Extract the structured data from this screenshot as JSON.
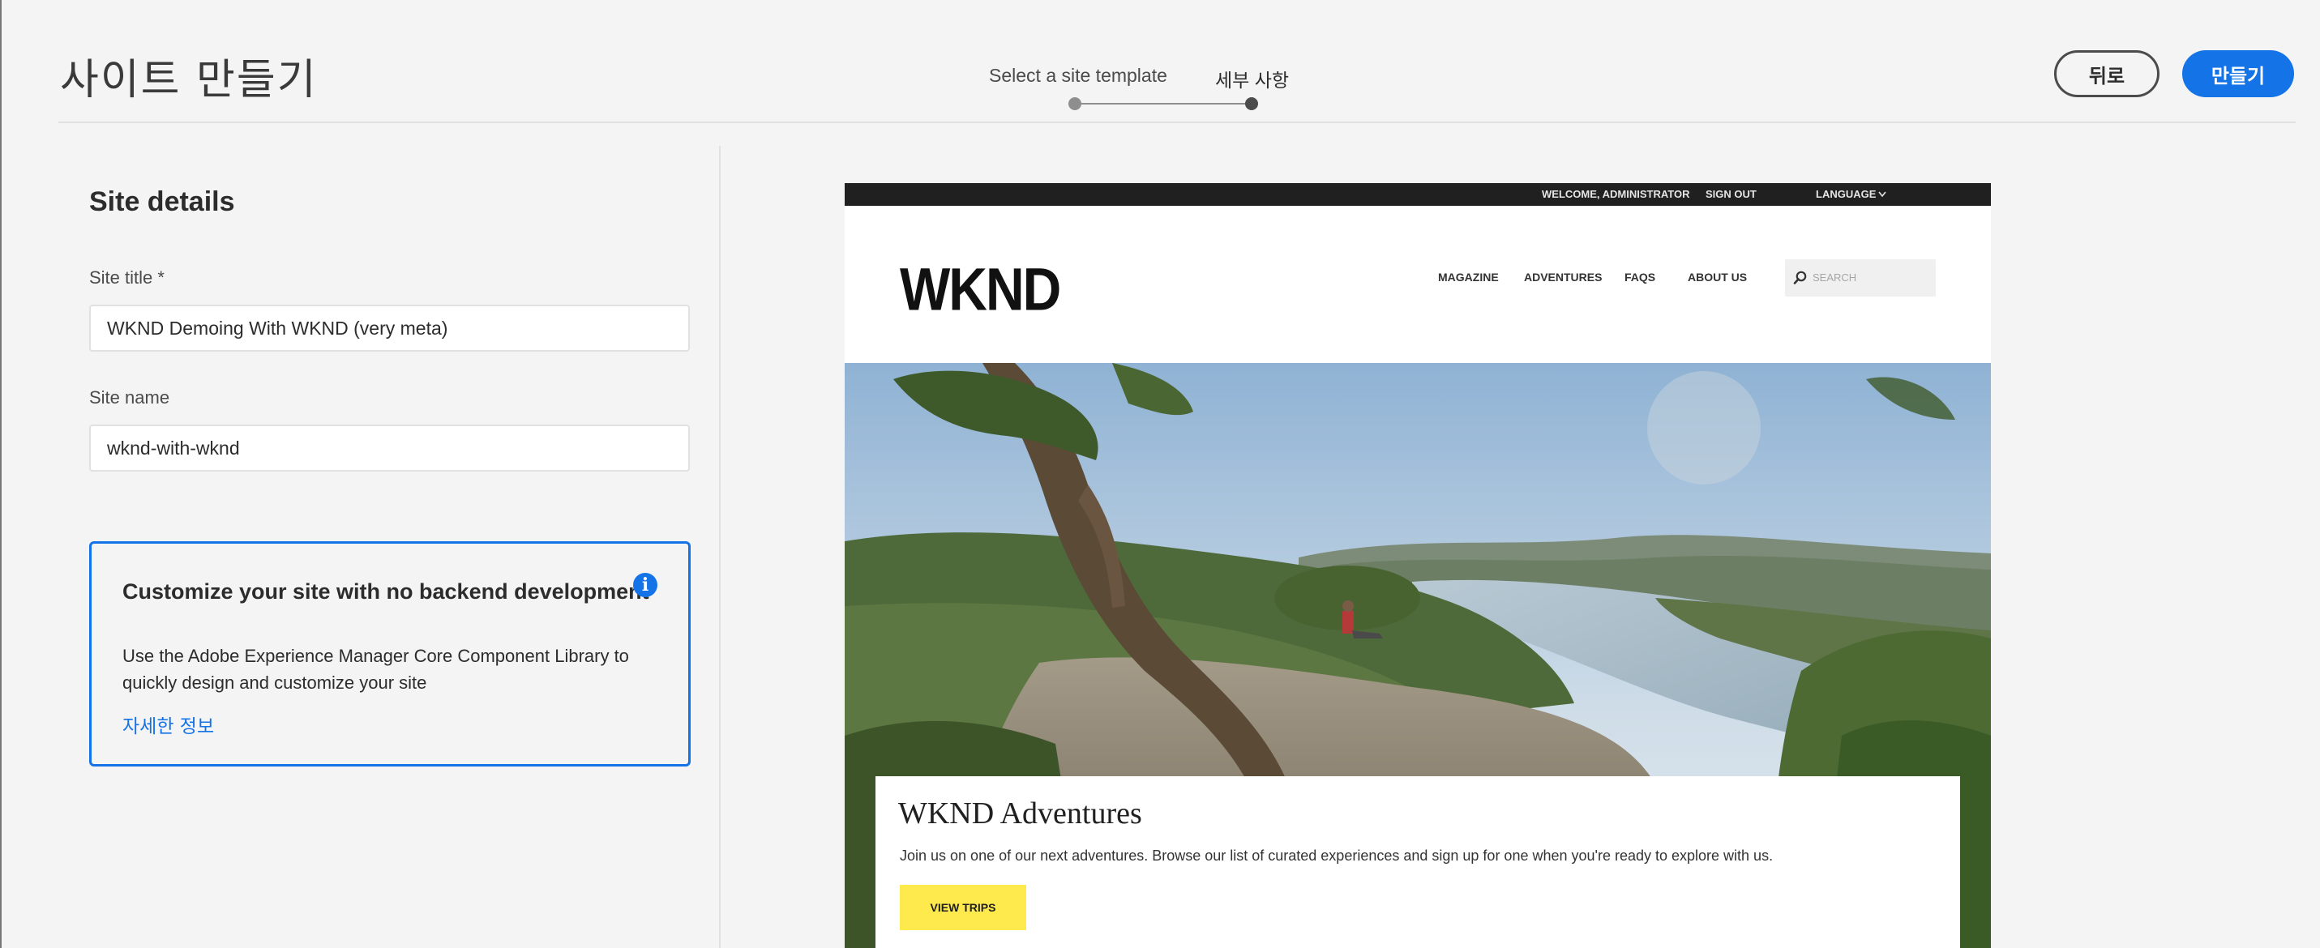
{
  "header": {
    "title": "사이트 만들기",
    "steps": [
      {
        "label": "Select a site template"
      },
      {
        "label": "세부 사항"
      }
    ],
    "back_label": "뒤로",
    "create_label": "만들기"
  },
  "site_details": {
    "heading": "Site details",
    "site_title_label": "Site title *",
    "site_title_value": "WKND Demoing With WKND (very meta)",
    "site_name_label": "Site name",
    "site_name_value": "wknd-with-wknd"
  },
  "info_card": {
    "title": "Customize your site with no backend development",
    "icon": "info-icon",
    "body": "Use the Adobe Experience Manager Core Component Library to quickly design and customize your site",
    "link": "자세한 정보"
  },
  "preview": {
    "top_welcome": "WELCOME, ADMINISTRATOR",
    "top_signout": "SIGN OUT",
    "top_language": "LANGUAGE",
    "logo": "WKND",
    "nav": [
      "MAGAZINE",
      "ADVENTURES",
      "FAQS",
      "ABOUT US"
    ],
    "search_placeholder": "SEARCH",
    "hero_title": "WKND Adventures",
    "hero_text": "Join us on one of our next adventures. Browse our list of curated experiences and sign up for one when you're ready to explore with us.",
    "hero_button": "VIEW TRIPS"
  },
  "colors": {
    "accent": "#1473e6",
    "background": "#f4f4f4",
    "preview_button": "#ffea4e"
  }
}
